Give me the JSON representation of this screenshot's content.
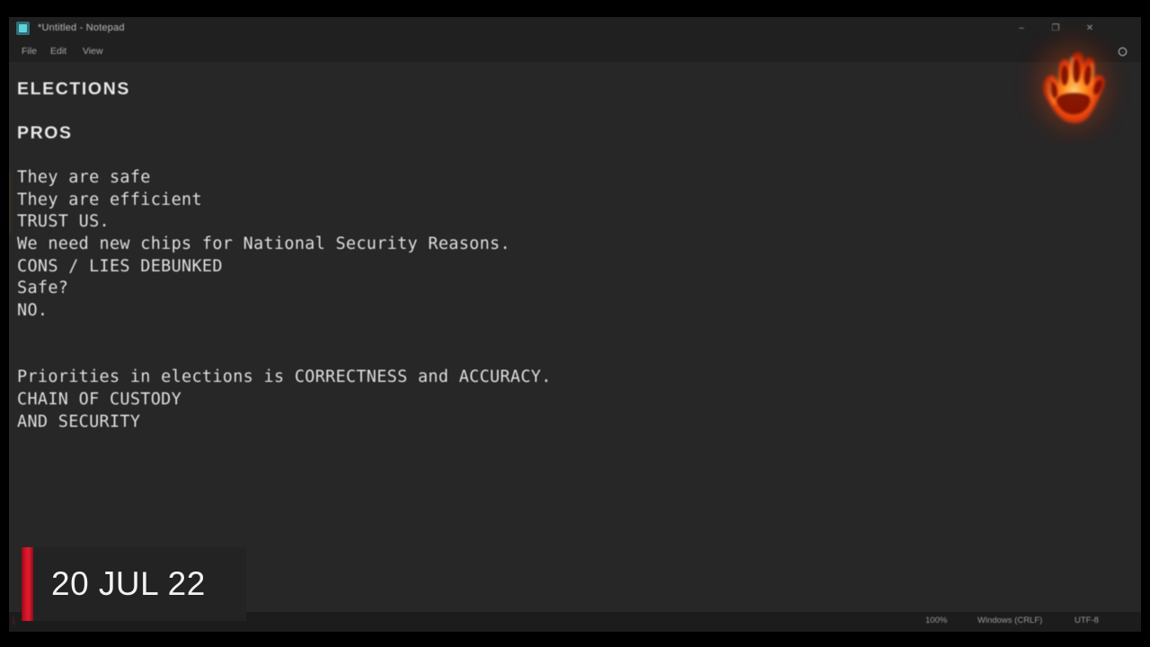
{
  "window": {
    "title": "*Untitled - Notepad",
    "app_icon": "notepad-icon",
    "controls": {
      "minimize": "–",
      "maximize": "❐",
      "close": "✕"
    }
  },
  "menu": {
    "items": [
      {
        "label": "File"
      },
      {
        "label": "Edit"
      },
      {
        "label": "View"
      }
    ],
    "settings_icon": "gear-icon"
  },
  "document": {
    "lines": [
      {
        "text": "ELECTIONS",
        "style": "heading"
      },
      {
        "text": "",
        "style": "blank"
      },
      {
        "text": "PROS",
        "style": "heading"
      },
      {
        "text": "",
        "style": "blank"
      },
      {
        "text": "They are safe",
        "style": "body"
      },
      {
        "text": "They are efficient",
        "style": "body"
      },
      {
        "text": "TRUST US.",
        "style": "body"
      },
      {
        "text": "We need new chips for National Security Reasons.",
        "style": "body"
      },
      {
        "text": "CONS / LIES DEBUNKED",
        "style": "body"
      },
      {
        "text": "Safe?",
        "style": "body"
      },
      {
        "text": "NO.",
        "style": "body"
      },
      {
        "text": "",
        "style": "blank"
      },
      {
        "text": "",
        "style": "blank"
      },
      {
        "text": "Priorities in elections is CORRECTNESS and ACCURACY.",
        "style": "body"
      },
      {
        "text": "CHAIN OF CUSTODY",
        "style": "body"
      },
      {
        "text": "AND SECURITY",
        "style": "body"
      }
    ]
  },
  "status_bar": {
    "zoom": "100%",
    "line_ending": "Windows (CRLF)",
    "encoding": "UTF-8"
  },
  "overlays": {
    "date_stamp": {
      "text": "20 JUL 22",
      "accent_color": "#d8152a"
    },
    "hand_logo": {
      "name": "fiery-handprint-logo",
      "colors": {
        "core": "#b31206",
        "mid": "#e8420a",
        "hot": "#ff8a1e",
        "glow": "#ffb347"
      }
    }
  },
  "colors": {
    "window_chrome": "#202020",
    "editor_background": "#272727",
    "text": "#e3e3e3",
    "status_text": "#9b9b9b",
    "letterbox": "#000000"
  }
}
